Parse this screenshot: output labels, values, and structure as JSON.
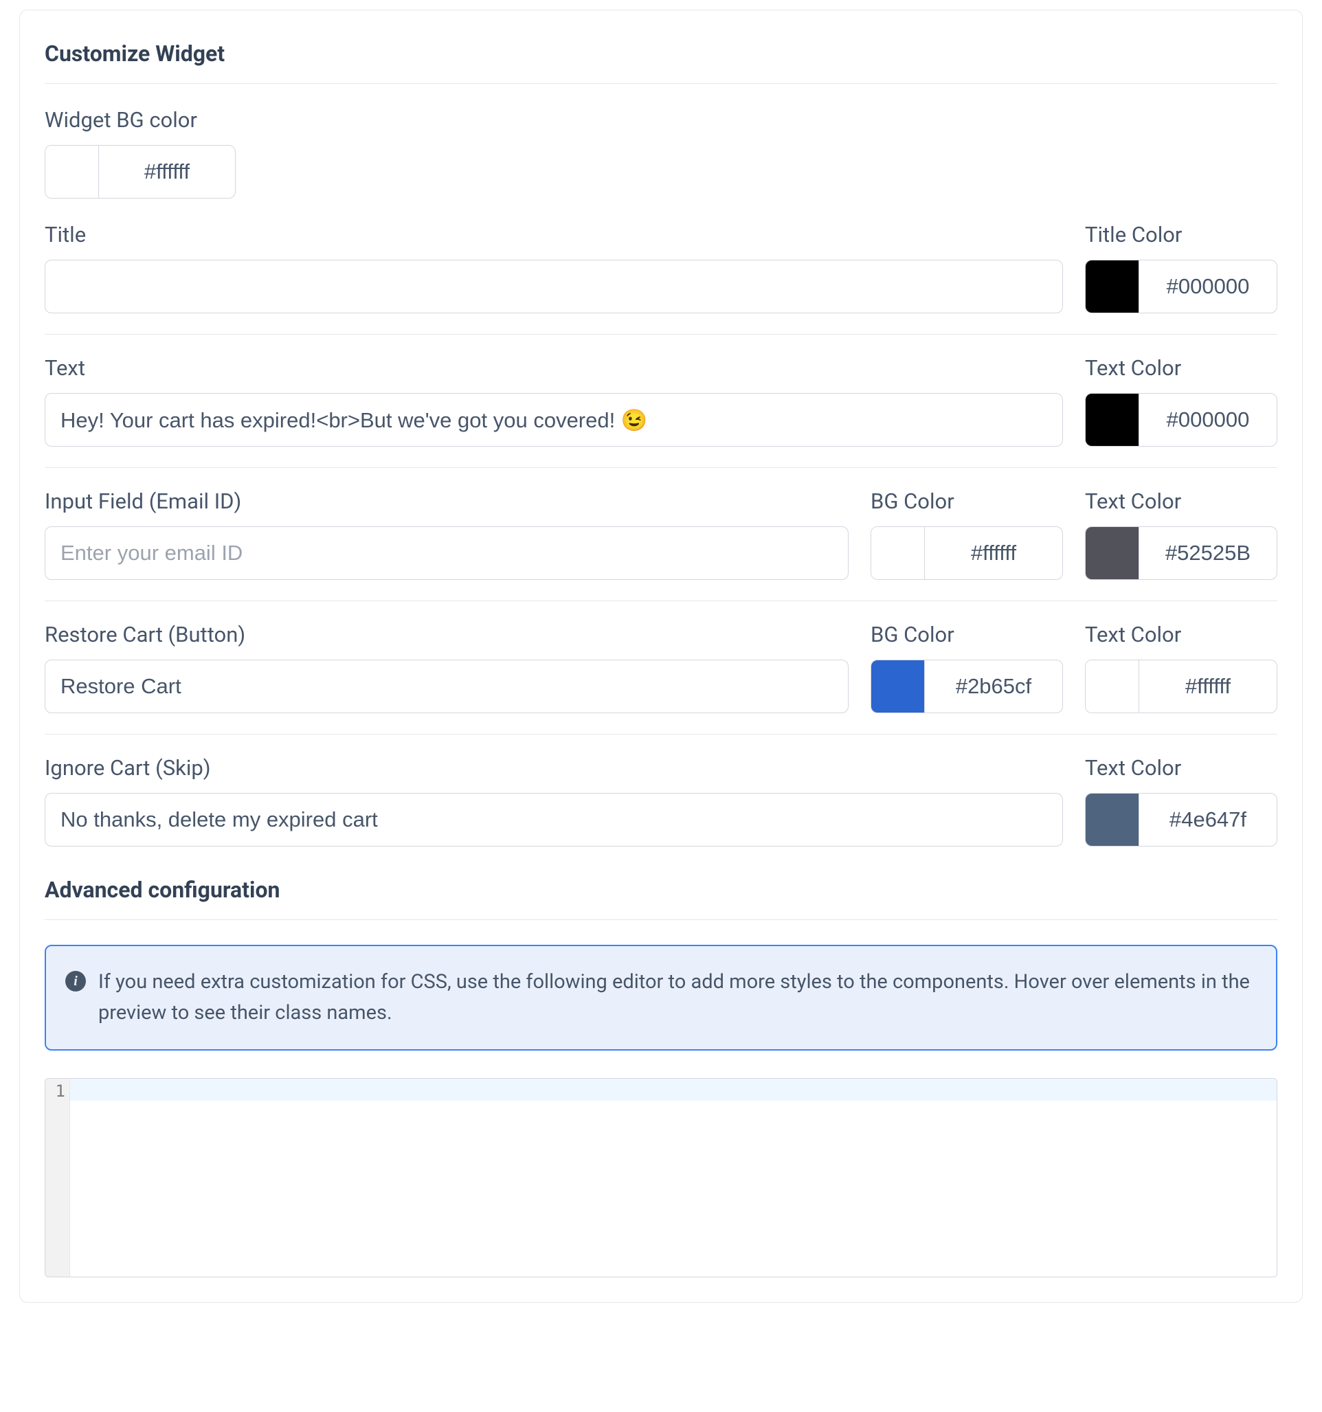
{
  "section1_title": "Customize Widget",
  "widget_bg": {
    "label": "Widget BG color",
    "value": "#ffffff",
    "swatch": "#ffffff"
  },
  "title_row": {
    "title_label": "Title",
    "title_value": "",
    "color_label": "Title Color",
    "color_value": "#000000",
    "color_swatch": "#000000"
  },
  "text_row": {
    "text_label": "Text",
    "text_value": "Hey! Your cart has expired!<br>But we've got you covered! 😉",
    "color_label": "Text Color",
    "color_value": "#000000",
    "color_swatch": "#000000"
  },
  "input_row": {
    "label": "Input Field (Email ID)",
    "placeholder": "Enter your email ID",
    "value": "",
    "bg_label": "BG Color",
    "bg_value": "#ffffff",
    "bg_swatch": "#ffffff",
    "txt_label": "Text Color",
    "txt_value": "#52525B",
    "txt_swatch": "#52525B"
  },
  "restore_row": {
    "label": "Restore Cart (Button)",
    "value": "Restore Cart",
    "bg_label": "BG Color",
    "bg_value": "#2b65cf",
    "bg_swatch": "#2b65cf",
    "txt_label": "Text Color",
    "txt_value": "#ffffff",
    "txt_swatch": "#ffffff"
  },
  "ignore_row": {
    "label": "Ignore Cart (Skip)",
    "value": "No thanks, delete my expired cart",
    "txt_label": "Text Color",
    "txt_value": "#4e647f",
    "txt_swatch": "#4e647f"
  },
  "section2_title": "Advanced configuration",
  "info_text": "If you need extra customization for CSS, use the following editor to add more styles to the components. Hover over elements in the preview to see their class names.",
  "editor": {
    "gutter": "1",
    "content": ""
  }
}
